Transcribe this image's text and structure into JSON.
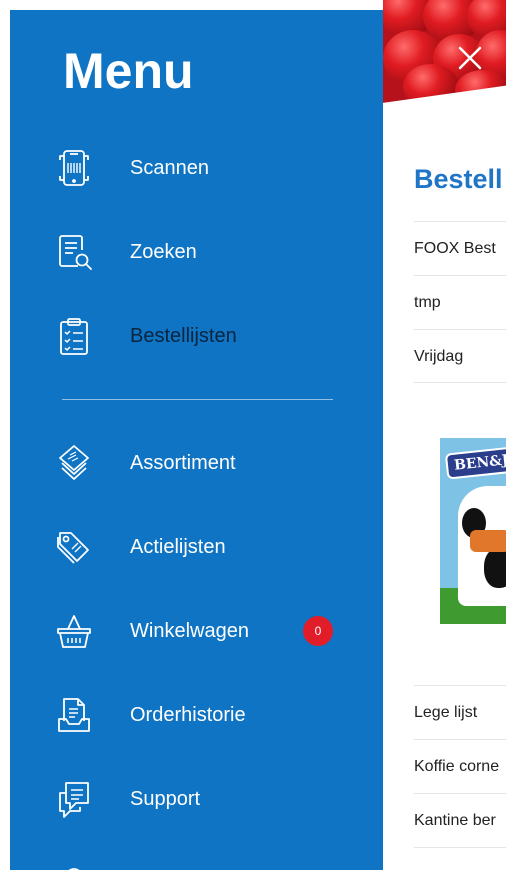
{
  "drawer": {
    "title": "Menu",
    "items": [
      {
        "label": "Scannen",
        "icon": "barcode-scanner-phone-icon"
      },
      {
        "label": "Zoeken",
        "icon": "document-search-icon"
      },
      {
        "label": "Bestellijsten",
        "icon": "clipboard-checklist-icon",
        "active": true
      },
      {
        "label": "Assortiment",
        "icon": "layers-stack-icon"
      },
      {
        "label": "Actielijsten",
        "icon": "price-tags-icon"
      },
      {
        "label": "Winkelwagen",
        "icon": "shopping-basket-icon",
        "badge": "0"
      },
      {
        "label": "Orderhistorie",
        "icon": "order-history-document-icon"
      },
      {
        "label": "Support",
        "icon": "support-chat-icon"
      }
    ]
  },
  "page": {
    "title": "Bestell",
    "lists_top": [
      "FOOX Best",
      "tmp",
      "Vrijdag"
    ],
    "promo_logo": "BEN&J",
    "lists_bottom": [
      "Lege lijst",
      "Koffie corne",
      "Kantine ber"
    ]
  },
  "colors": {
    "drawer_bg": "#0f74c3",
    "accent_title": "#1f75c6",
    "badge_red": "#e11d2a",
    "active_label": "#0a2540"
  }
}
